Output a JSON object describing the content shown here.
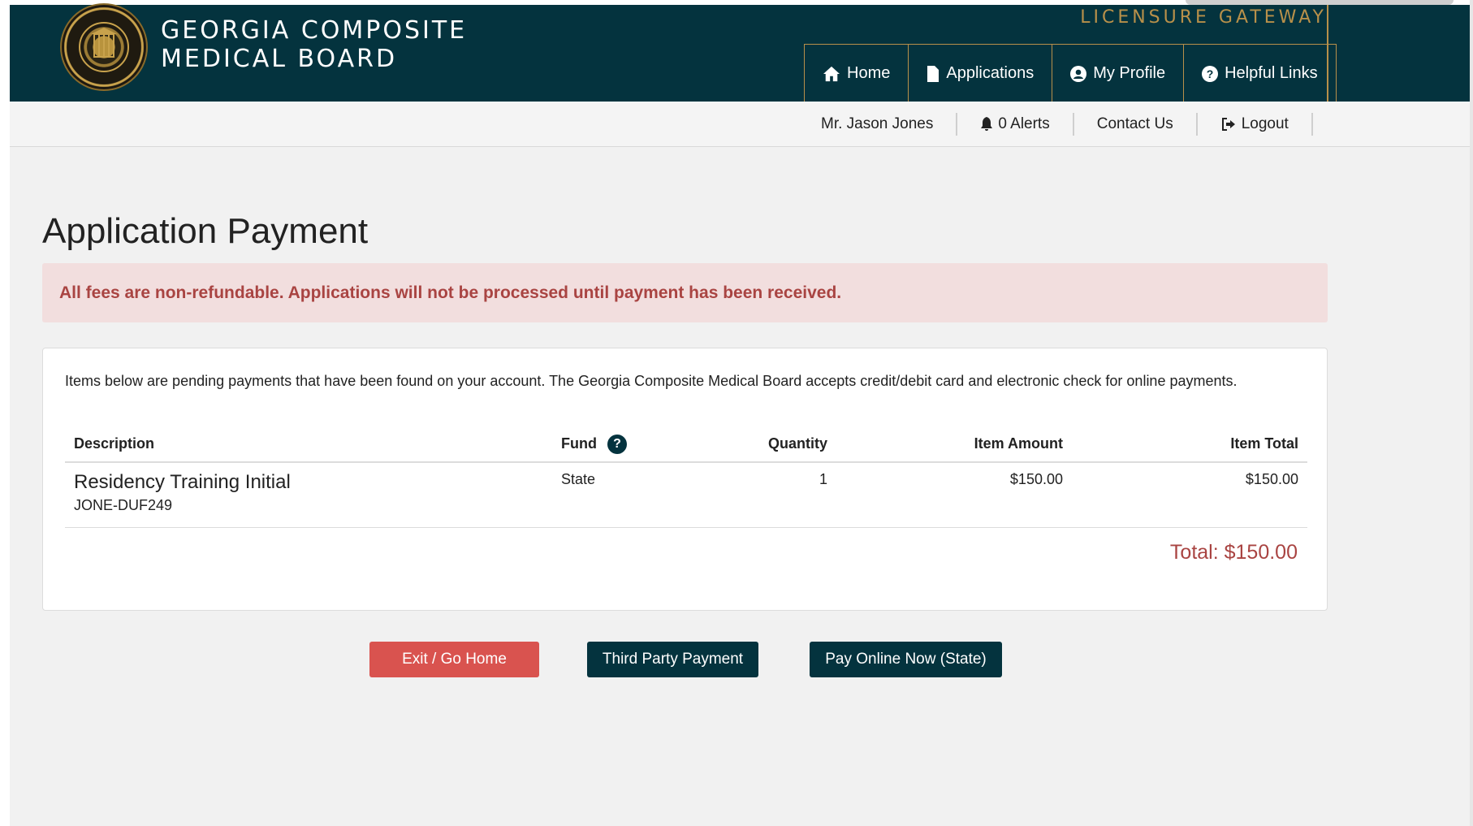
{
  "header": {
    "brand_line1": "GEORGIA COMPOSITE",
    "brand_line2": "MEDICAL BOARD",
    "gateway": "LICENSURE GATEWAY",
    "seal_icon": "state-seal-icon",
    "colors": {
      "background": "#04333e",
      "accent": "#b8904a"
    }
  },
  "nav": {
    "items": [
      {
        "label": "Home",
        "icon": "home-icon"
      },
      {
        "label": "Applications",
        "icon": "document-icon"
      },
      {
        "label": "My Profile",
        "icon": "user-circle-icon"
      },
      {
        "label": "Helpful Links",
        "icon": "question-circle-icon"
      }
    ]
  },
  "userbar": {
    "user_name": "Mr. Jason Jones",
    "alerts": "0 Alerts",
    "contact": "Contact Us",
    "logout": "Logout"
  },
  "main": {
    "title": "Application Payment",
    "alert": "All fees are non-refundable. Applications will not be processed until payment has been received.",
    "intro": "Items below are pending payments that have been found on your account. The Georgia Composite Medical Board accepts credit/debit card and electronic check for online payments.",
    "table": {
      "headers": {
        "description": "Description",
        "fund": "Fund",
        "quantity": "Quantity",
        "item_amount": "Item Amount",
        "item_total": "Item Total"
      },
      "rows": [
        {
          "description": "Residency Training Initial",
          "reference": "JONE-DUF249",
          "fund": "State",
          "quantity": "1",
          "item_amount": "$150.00",
          "item_total": "$150.00"
        }
      ]
    },
    "total": "Total: $150.00"
  },
  "buttons": {
    "exit": "Exit / Go Home",
    "third_party": "Third Party Payment",
    "pay_online": "Pay Online Now (State)"
  },
  "colors": {
    "alert_bg": "#f2dede",
    "alert_text": "#a94442",
    "danger_button": "#d9534f",
    "primary_button": "#04333e"
  }
}
